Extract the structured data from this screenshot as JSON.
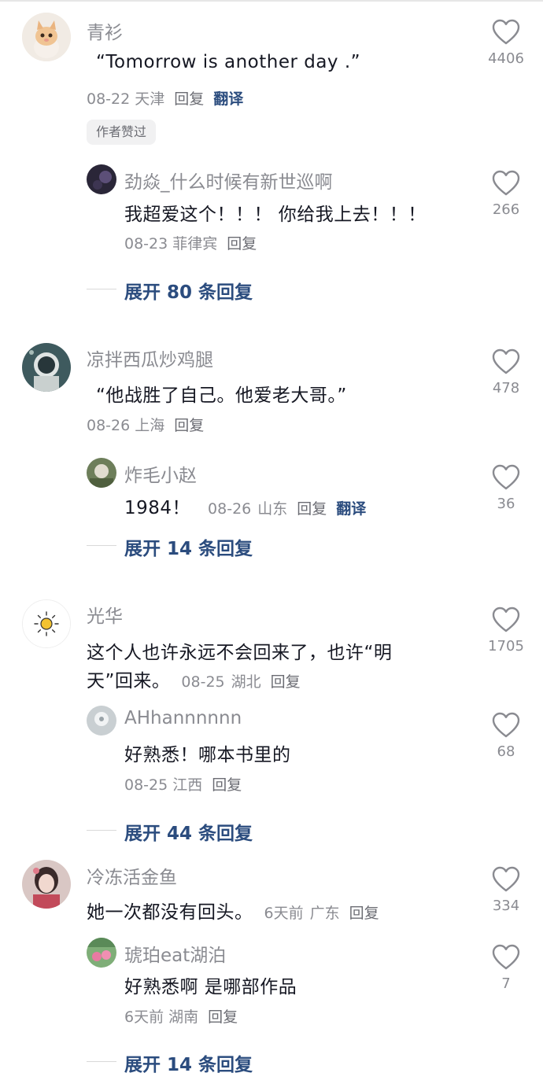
{
  "comments": [
    {
      "user": "青衫",
      "content": "“Tomorrow is another day .”",
      "date": "08-22",
      "location": "天津",
      "reply_label": "回复",
      "translate_label": "翻译",
      "author_liked": "作者赞过",
      "likes": "4406",
      "replies": [
        {
          "user": "劲焱_什么时候有新世巡啊",
          "content": "我超爱这个！！！ 你给我上去！！！",
          "date": "08-23",
          "location": "菲律宾",
          "reply_label": "回复",
          "likes": "266"
        }
      ],
      "expand_label": "展开 80 条回复"
    },
    {
      "user": "凉拌西瓜炒鸡腿",
      "content": "“他战胜了自己。他爱老大哥。”",
      "date": "08-26",
      "location": "上海",
      "reply_label": "回复",
      "likes": "478",
      "replies": [
        {
          "user": "炸毛小赵",
          "content": "1984！",
          "date": "08-26",
          "location": "山东",
          "reply_label": "回复",
          "translate_label": "翻译",
          "likes": "36"
        }
      ],
      "expand_label": "展开 14 条回复"
    },
    {
      "user": "光华",
      "content_line1": "这个人也许永远不会回来了，也许“明",
      "content_line2": "天”回来。",
      "date": "08-25",
      "location": "湖北",
      "reply_label": "回复",
      "likes": "1705",
      "replies": [
        {
          "user": "AHhannnnnn",
          "content": "好熟悉！哪本书里的",
          "date": "08-25",
          "location": "江西",
          "reply_label": "回复",
          "likes": "68"
        }
      ],
      "expand_label": "展开 44 条回复"
    },
    {
      "user": "冷冻活金鱼",
      "content": "她一次都没有回头。",
      "date": "6天前",
      "location": "广东",
      "reply_label": "回复",
      "likes": "334",
      "replies": [
        {
          "user": "琥珀eat湖泊",
          "content": "好熟悉啊 是哪部作品",
          "date": "6天前",
          "location": "湖南",
          "reply_label": "回复",
          "likes": "7"
        }
      ],
      "expand_label": "展开 14 条回复"
    }
  ],
  "icons": {
    "like": "heart-outline-icon"
  },
  "colors": {
    "link": "#2b4c7e",
    "meta": "#8a8b91",
    "text": "#161823"
  }
}
